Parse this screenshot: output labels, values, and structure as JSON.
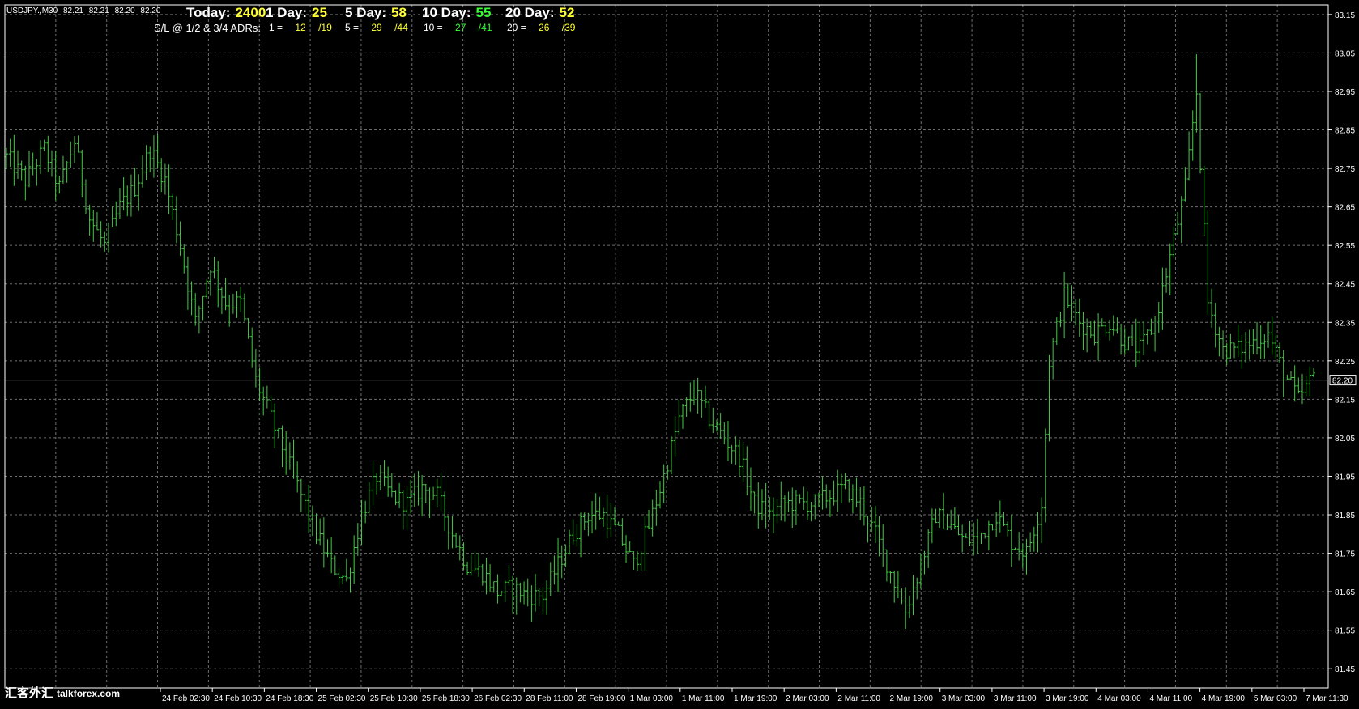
{
  "window": {
    "symbol": "USDJPY.,M30",
    "ohlc": [
      "82.21",
      "82.21",
      "82.20",
      "82.20"
    ]
  },
  "adr": {
    "row1": [
      {
        "label": "Today:",
        "value": "2400",
        "color": "#ffff33"
      },
      {
        "label": "1 Day:",
        "value": "25",
        "color": "#ffff33"
      },
      {
        "label": "5 Day:",
        "value": "58",
        "color": "#ffff33"
      },
      {
        "label": "10 Day:",
        "value": "55",
        "color": "#33ff33"
      },
      {
        "label": "20 Day:",
        "value": "52",
        "color": "#ffff33"
      }
    ],
    "row2_label": "S/L @ 1/2 & 3/4 ADRs:",
    "row2": [
      {
        "key": "1 =",
        "half": "12",
        "three_quarter": "/19",
        "color": "#ffff33"
      },
      {
        "key": "5 =",
        "half": "29",
        "three_quarter": "/44",
        "color": "#ffff33"
      },
      {
        "key": "10 =",
        "half": "27",
        "three_quarter": "/41",
        "color": "#33ff33"
      },
      {
        "key": "20 =",
        "half": "26",
        "three_quarter": "/39",
        "color": "#ffff33"
      }
    ]
  },
  "colors": {
    "background": "#000000",
    "grid": "#6e6e6e",
    "bars": "#44cc44",
    "axis_text": "#ffffff",
    "current_price_line": "#9a9a9a"
  },
  "chart_data": {
    "type": "bar",
    "ylim": [
      81.4,
      83.175
    ],
    "yticks": [
      "83.15",
      "83.05",
      "82.95",
      "82.85",
      "82.75",
      "82.65",
      "82.55",
      "82.45",
      "82.35",
      "82.25",
      "82.15",
      "82.05",
      "81.95",
      "81.85",
      "81.75",
      "81.65",
      "81.55",
      "81.45"
    ],
    "xtick_labels": [
      "24 Feb 02:30",
      "24 Feb 10:30",
      "24 Feb 18:30",
      "25 Feb 02:30",
      "25 Feb 10:30",
      "25 Feb 18:30",
      "26 Feb 02:30",
      "28 Feb 11:00",
      "28 Feb 19:00",
      "1 Mar 03:00",
      "1 Mar 11:00",
      "1 Mar 19:00",
      "2 Mar 03:00",
      "2 Mar 11:00",
      "2 Mar 19:00",
      "3 Mar 03:00",
      "3 Mar 11:00",
      "3 Mar 19:00",
      "4 Mar 03:00",
      "4 Mar 11:00",
      "4 Mar 19:00",
      "5 Mar 03:00",
      "7 Mar 11:30"
    ],
    "current_price": "82.20",
    "grid": true,
    "keypoints": [
      [
        0,
        82.78
      ],
      [
        5,
        82.72
      ],
      [
        10,
        82.8
      ],
      [
        14,
        82.7
      ],
      [
        18,
        82.82
      ],
      [
        22,
        82.62
      ],
      [
        26,
        82.55
      ],
      [
        30,
        82.65
      ],
      [
        34,
        82.7
      ],
      [
        38,
        82.8
      ],
      [
        42,
        82.72
      ],
      [
        46,
        82.55
      ],
      [
        50,
        82.35
      ],
      [
        54,
        82.5
      ],
      [
        58,
        82.4
      ],
      [
        62,
        82.4
      ],
      [
        66,
        82.2
      ],
      [
        70,
        82.1
      ],
      [
        74,
        82.0
      ],
      [
        78,
        81.9
      ],
      [
        82,
        81.8
      ],
      [
        86,
        81.72
      ],
      [
        90,
        81.68
      ],
      [
        94,
        81.85
      ],
      [
        98,
        81.95
      ],
      [
        102,
        81.9
      ],
      [
        106,
        81.88
      ],
      [
        110,
        81.92
      ],
      [
        114,
        81.9
      ],
      [
        118,
        81.8
      ],
      [
        122,
        81.72
      ],
      [
        126,
        81.7
      ],
      [
        130,
        81.65
      ],
      [
        134,
        81.66
      ],
      [
        138,
        81.64
      ],
      [
        142,
        81.64
      ],
      [
        146,
        81.72
      ],
      [
        150,
        81.8
      ],
      [
        154,
        81.85
      ],
      [
        158,
        81.85
      ],
      [
        162,
        81.8
      ],
      [
        166,
        81.72
      ],
      [
        170,
        81.82
      ],
      [
        174,
        81.95
      ],
      [
        178,
        82.1
      ],
      [
        182,
        82.17
      ],
      [
        186,
        82.1
      ],
      [
        190,
        82.05
      ],
      [
        194,
        82.0
      ],
      [
        198,
        81.88
      ],
      [
        202,
        81.85
      ],
      [
        206,
        81.88
      ],
      [
        210,
        81.88
      ],
      [
        214,
        81.88
      ],
      [
        218,
        81.9
      ],
      [
        222,
        81.92
      ],
      [
        226,
        81.88
      ],
      [
        230,
        81.8
      ],
      [
        234,
        81.7
      ],
      [
        238,
        81.6
      ],
      [
        242,
        81.72
      ],
      [
        246,
        81.85
      ],
      [
        250,
        81.82
      ],
      [
        254,
        81.78
      ],
      [
        258,
        81.8
      ],
      [
        262,
        81.85
      ],
      [
        266,
        81.78
      ],
      [
        270,
        81.75
      ],
      [
        274,
        81.88
      ],
      [
        276,
        82.25
      ],
      [
        280,
        82.42
      ],
      [
        284,
        82.35
      ],
      [
        288,
        82.32
      ],
      [
        292,
        82.35
      ],
      [
        296,
        82.3
      ],
      [
        300,
        82.28
      ],
      [
        304,
        82.35
      ],
      [
        308,
        82.52
      ],
      [
        312,
        82.7
      ],
      [
        315,
        82.95
      ],
      [
        318,
        82.4
      ],
      [
        322,
        82.28
      ],
      [
        326,
        82.28
      ],
      [
        330,
        82.3
      ],
      [
        334,
        82.32
      ],
      [
        338,
        82.22
      ],
      [
        342,
        82.15
      ],
      [
        346,
        82.21
      ]
    ]
  },
  "watermark": {
    "text": "汇客外汇",
    "site": "talkforex.com"
  }
}
